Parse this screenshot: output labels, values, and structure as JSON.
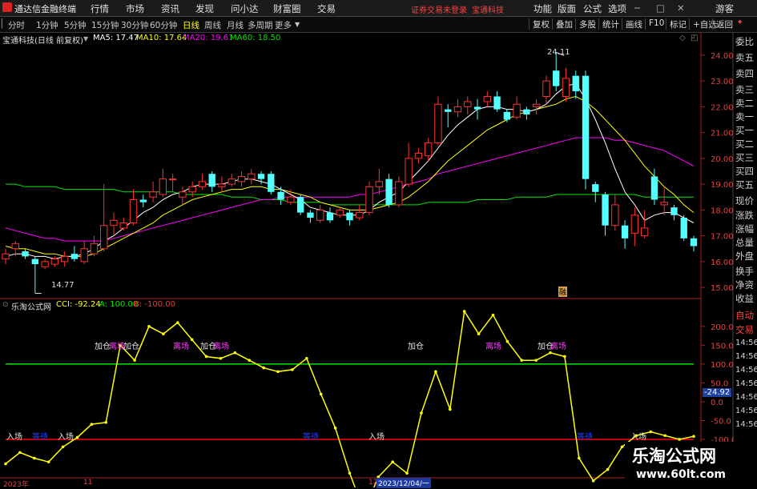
{
  "app": {
    "title": "通达信金融终端"
  },
  "menu": {
    "items": [
      "行情",
      "市场",
      "资讯",
      "发现",
      "问小达",
      "财富圈",
      "交易"
    ],
    "warning": "证券交易未登录",
    "broker": "宝通科技",
    "right_items": [
      "功能",
      "版面",
      "公式",
      "选项"
    ],
    "guest": "游客"
  },
  "toolbar": {
    "periods": [
      "分时",
      "1分钟",
      "5分钟",
      "15分钟",
      "30分钟",
      "60分钟",
      "日线",
      "周线",
      "月线",
      "多周期",
      "更多"
    ],
    "active": "日线",
    "right_buttons": [
      "复权",
      "叠加",
      "多股",
      "统计",
      "画线",
      "F10",
      "标记",
      "+自选",
      "返回"
    ]
  },
  "stock": {
    "name": "宝通科技(日线 前复权)",
    "ma5": "MA5: 17.47",
    "ma10": "MA10: 17.64",
    "ma20": "MA20: 19.61",
    "ma60": "MA60: 18.50",
    "high_label": "24.11",
    "low_label": "14.77",
    "badge": "融"
  },
  "indicator": {
    "title": "乐淘公式网",
    "cci": "CCI: -92.24",
    "a": "A: 100.00",
    "b": "B: -100.00",
    "current_value": "-24.92"
  },
  "signals": {
    "ruchang": "入场",
    "jiacang": "加仓",
    "lichang": "离场",
    "dengdai": "等待"
  },
  "x_axis": {
    "labels": [
      "2023年",
      "11",
      "12",
      "2023/12/04/一"
    ]
  },
  "side_panel": {
    "items": [
      "委比",
      "卖五",
      "卖四",
      "卖三",
      "卖二",
      "卖一",
      "买一",
      "买二",
      "买三",
      "买四",
      "买五",
      "现价",
      "涨跌",
      "涨幅",
      "总量",
      "外盘",
      "换手",
      "净资",
      "收益",
      "自动",
      "交易"
    ]
  },
  "right_scale": {
    "items": [
      "14:56",
      "14:56",
      "14:56",
      "14:56",
      "14:56",
      "14:56",
      "14:56"
    ]
  },
  "watermark": {
    "brand": "乐淘公式网",
    "url": "www.60lt.com"
  },
  "colors": {
    "up": "#ff3232",
    "down": "#54ffff",
    "ma5": "#ffffff",
    "ma10": "#ffff00",
    "ma20": "#ff00ff",
    "ma60": "#00e600",
    "cci": "#ffff00",
    "line_a": "#00e600",
    "line_b": "#ff0000"
  },
  "chart_data": [
    {
      "type": "candlestick",
      "title": "宝通科技(日线 前复权)",
      "ylim": [
        14.6,
        24.4
      ],
      "y_ticks": [
        15,
        16,
        17,
        18,
        19,
        20,
        21,
        22,
        23,
        24
      ],
      "y_tick_labels": [
        "15.00",
        "16.00",
        "17.00",
        "18.00",
        "19.00",
        "20.00",
        "21.00",
        "22.00",
        "23.00",
        "24.00"
      ],
      "candles": [
        {
          "o": 16.1,
          "c": 16.3,
          "h": 16.5,
          "l": 15.9
        },
        {
          "o": 16.5,
          "c": 16.7,
          "h": 16.8,
          "l": 16.2
        },
        {
          "o": 16.4,
          "c": 16.2,
          "h": 16.5,
          "l": 16.1
        },
        {
          "o": 16.1,
          "c": 15.9,
          "h": 16.2,
          "l": 14.77
        },
        {
          "o": 15.8,
          "c": 16.0,
          "h": 16.1,
          "l": 15.7
        },
        {
          "o": 15.9,
          "c": 16.1,
          "h": 16.2,
          "l": 15.8
        },
        {
          "o": 16.0,
          "c": 16.2,
          "h": 16.4,
          "l": 15.8
        },
        {
          "o": 16.3,
          "c": 16.1,
          "h": 16.6,
          "l": 16.0
        },
        {
          "o": 16.0,
          "c": 16.5,
          "h": 16.8,
          "l": 15.9
        },
        {
          "o": 16.3,
          "c": 16.7,
          "h": 17.0,
          "l": 16.2
        },
        {
          "o": 16.5,
          "c": 17.4,
          "h": 19.0,
          "l": 16.4
        },
        {
          "o": 17.4,
          "c": 17.6,
          "h": 17.9,
          "l": 17.0
        },
        {
          "o": 17.3,
          "c": 17.5,
          "h": 17.7,
          "l": 17.2
        },
        {
          "o": 17.5,
          "c": 18.4,
          "h": 18.8,
          "l": 17.4
        },
        {
          "o": 18.4,
          "c": 18.3,
          "h": 18.6,
          "l": 18.1
        },
        {
          "o": 18.5,
          "c": 18.7,
          "h": 19.1,
          "l": 18.3
        },
        {
          "o": 18.6,
          "c": 19.2,
          "h": 19.6,
          "l": 18.5
        },
        {
          "o": 19.2,
          "c": 19.2,
          "h": 19.4,
          "l": 18.7
        },
        {
          "o": 18.5,
          "c": 18.7,
          "h": 18.9,
          "l": 18.2
        },
        {
          "o": 18.7,
          "c": 18.9,
          "h": 19.1,
          "l": 18.5
        },
        {
          "o": 18.9,
          "c": 19.1,
          "h": 19.4,
          "l": 18.8
        },
        {
          "o": 19.4,
          "c": 18.9,
          "h": 19.5,
          "l": 18.7
        },
        {
          "o": 18.9,
          "c": 19.0,
          "h": 19.3,
          "l": 18.7
        },
        {
          "o": 19.0,
          "c": 19.2,
          "h": 19.4,
          "l": 18.9
        },
        {
          "o": 19.1,
          "c": 19.3,
          "h": 19.5,
          "l": 18.9
        },
        {
          "o": 19.2,
          "c": 19.4,
          "h": 19.6,
          "l": 19.0
        },
        {
          "o": 19.4,
          "c": 19.2,
          "h": 19.5,
          "l": 19.0
        },
        {
          "o": 19.4,
          "c": 18.7,
          "h": 19.5,
          "l": 18.6
        },
        {
          "o": 18.7,
          "c": 18.4,
          "h": 18.9,
          "l": 18.2
        },
        {
          "o": 18.3,
          "c": 18.5,
          "h": 18.8,
          "l": 18.2
        },
        {
          "o": 18.5,
          "c": 17.9,
          "h": 18.6,
          "l": 17.8
        },
        {
          "o": 17.9,
          "c": 17.7,
          "h": 18.0,
          "l": 17.5
        },
        {
          "o": 17.6,
          "c": 18.0,
          "h": 18.2,
          "l": 17.5
        },
        {
          "o": 17.9,
          "c": 17.6,
          "h": 18.1,
          "l": 17.5
        },
        {
          "o": 17.8,
          "c": 18.0,
          "h": 18.1,
          "l": 17.7
        },
        {
          "o": 17.9,
          "c": 17.6,
          "h": 18.0,
          "l": 17.4
        },
        {
          "o": 17.7,
          "c": 17.9,
          "h": 18.2,
          "l": 17.6
        },
        {
          "o": 17.9,
          "c": 18.9,
          "h": 19.1,
          "l": 17.8
        },
        {
          "o": 18.9,
          "c": 19.1,
          "h": 19.6,
          "l": 18.6
        },
        {
          "o": 19.2,
          "c": 18.2,
          "h": 19.4,
          "l": 18.1
        },
        {
          "o": 18.2,
          "c": 19.1,
          "h": 19.3,
          "l": 18.1
        },
        {
          "o": 19.0,
          "c": 20.0,
          "h": 20.6,
          "l": 18.9
        },
        {
          "o": 20.0,
          "c": 20.2,
          "h": 20.4,
          "l": 19.8
        },
        {
          "o": 20.1,
          "c": 20.6,
          "h": 20.8,
          "l": 19.9
        },
        {
          "o": 20.6,
          "c": 22.1,
          "h": 22.4,
          "l": 20.5
        },
        {
          "o": 21.9,
          "c": 21.8,
          "h": 22.1,
          "l": 21.2
        },
        {
          "o": 21.8,
          "c": 22.0,
          "h": 22.3,
          "l": 21.6
        },
        {
          "o": 22.0,
          "c": 22.2,
          "h": 22.4,
          "l": 21.7
        },
        {
          "o": 22.0,
          "c": 21.9,
          "h": 22.3,
          "l": 21.5
        },
        {
          "o": 22.2,
          "c": 22.4,
          "h": 22.6,
          "l": 22.0
        },
        {
          "o": 22.4,
          "c": 21.9,
          "h": 22.6,
          "l": 21.8
        },
        {
          "o": 21.8,
          "c": 21.5,
          "h": 21.9,
          "l": 21.4
        },
        {
          "o": 21.6,
          "c": 22.1,
          "h": 22.4,
          "l": 21.5
        },
        {
          "o": 21.9,
          "c": 21.7,
          "h": 22.0,
          "l": 21.5
        },
        {
          "o": 22.0,
          "c": 22.1,
          "h": 22.3,
          "l": 21.7
        },
        {
          "o": 22.4,
          "c": 23.0,
          "h": 23.2,
          "l": 22.1
        },
        {
          "o": 23.4,
          "c": 22.8,
          "h": 24.11,
          "l": 22.6
        },
        {
          "o": 22.4,
          "c": 23.1,
          "h": 23.5,
          "l": 22.2
        },
        {
          "o": 23.2,
          "c": 22.6,
          "h": 23.4,
          "l": 22.3
        },
        {
          "o": 23.2,
          "c": 19.2,
          "h": 23.4,
          "l": 18.8
        },
        {
          "o": 19.0,
          "c": 18.7,
          "h": 19.1,
          "l": 18.3
        },
        {
          "o": 18.6,
          "c": 17.4,
          "h": 18.7,
          "l": 17.0
        },
        {
          "o": 17.4,
          "c": 18.2,
          "h": 18.6,
          "l": 17.2
        },
        {
          "o": 17.4,
          "c": 16.9,
          "h": 17.6,
          "l": 16.5
        },
        {
          "o": 17.1,
          "c": 17.8,
          "h": 18.1,
          "l": 16.6
        },
        {
          "o": 17.0,
          "c": 17.3,
          "h": 18.0,
          "l": 16.9
        },
        {
          "o": 19.3,
          "c": 18.4,
          "h": 19.6,
          "l": 18.2
        },
        {
          "o": 18.2,
          "c": 18.3,
          "h": 18.9,
          "l": 17.8
        },
        {
          "o": 18.1,
          "c": 17.8,
          "h": 18.2,
          "l": 17.6
        },
        {
          "o": 17.7,
          "c": 16.9,
          "h": 17.8,
          "l": 16.8
        },
        {
          "o": 16.9,
          "c": 16.6,
          "h": 17.0,
          "l": 16.4
        }
      ],
      "ma5": [
        16.2,
        16.3,
        16.3,
        16.2,
        16.2,
        16.1,
        16.2,
        16.2,
        16.3,
        16.5,
        16.8,
        17.0,
        17.3,
        17.6,
        17.9,
        18.1,
        18.4,
        18.6,
        18.7,
        18.9,
        19.0,
        19.0,
        19.0,
        19.1,
        19.2,
        19.2,
        19.1,
        19.0,
        18.8,
        18.6,
        18.4,
        18.1,
        18.0,
        17.9,
        17.8,
        17.8,
        17.8,
        18.0,
        18.3,
        18.5,
        18.7,
        19.1,
        19.5,
        19.9,
        20.4,
        20.9,
        21.3,
        21.6,
        21.9,
        22.0,
        22.0,
        21.9,
        21.9,
        21.8,
        21.9,
        22.1,
        22.5,
        22.8,
        22.9,
        22.3,
        21.5,
        20.6,
        19.6,
        18.7,
        18.2,
        17.6,
        17.8,
        17.9,
        17.9,
        17.7,
        17.5
      ],
      "ma10": [
        16.6,
        16.5,
        16.5,
        16.4,
        16.3,
        16.3,
        16.2,
        16.2,
        16.2,
        16.3,
        16.5,
        16.7,
        16.9,
        17.1,
        17.3,
        17.5,
        17.8,
        18.0,
        18.2,
        18.4,
        18.5,
        18.6,
        18.7,
        18.8,
        18.8,
        18.9,
        18.9,
        18.8,
        18.8,
        18.7,
        18.6,
        18.5,
        18.3,
        18.2,
        18.1,
        18.0,
        18.0,
        18.0,
        18.1,
        18.2,
        18.3,
        18.5,
        18.8,
        19.1,
        19.5,
        19.9,
        20.2,
        20.5,
        20.8,
        21.1,
        21.3,
        21.5,
        21.7,
        21.8,
        21.9,
        22.0,
        22.1,
        22.3,
        22.4,
        22.2,
        21.9,
        21.5,
        21.1,
        20.7,
        20.2,
        19.7,
        19.3,
        18.9,
        18.6,
        18.2,
        17.9
      ],
      "ma20": [
        17.3,
        17.2,
        17.1,
        17.0,
        16.9,
        16.9,
        16.8,
        16.8,
        16.8,
        16.8,
        16.8,
        16.9,
        17.0,
        17.1,
        17.2,
        17.3,
        17.4,
        17.5,
        17.6,
        17.7,
        17.8,
        17.9,
        18.0,
        18.1,
        18.2,
        18.3,
        18.4,
        18.4,
        18.5,
        18.5,
        18.5,
        18.5,
        18.5,
        18.5,
        18.5,
        18.5,
        18.6,
        18.6,
        18.7,
        18.8,
        18.9,
        19.0,
        19.1,
        19.2,
        19.4,
        19.5,
        19.6,
        19.7,
        19.8,
        19.9,
        20.0,
        20.1,
        20.2,
        20.3,
        20.4,
        20.5,
        20.6,
        20.7,
        20.8,
        20.8,
        20.8,
        20.8,
        20.7,
        20.7,
        20.6,
        20.5,
        20.4,
        20.3,
        20.1,
        19.9,
        19.7
      ],
      "ma60": [
        19.0,
        19.0,
        18.9,
        18.9,
        18.9,
        18.9,
        18.8,
        18.8,
        18.8,
        18.8,
        18.8,
        18.8,
        18.7,
        18.7,
        18.7,
        18.7,
        18.7,
        18.7,
        18.6,
        18.6,
        18.6,
        18.6,
        18.6,
        18.5,
        18.5,
        18.5,
        18.4,
        18.4,
        18.4,
        18.3,
        18.3,
        18.3,
        18.3,
        18.2,
        18.2,
        18.2,
        18.2,
        18.2,
        18.2,
        18.2,
        18.2,
        18.2,
        18.2,
        18.3,
        18.3,
        18.3,
        18.3,
        18.3,
        18.4,
        18.4,
        18.4,
        18.4,
        18.5,
        18.5,
        18.5,
        18.5,
        18.6,
        18.6,
        18.6,
        18.6,
        18.6,
        18.6,
        18.6,
        18.6,
        18.6,
        18.5,
        18.5,
        18.5,
        18.5,
        18.5,
        18.5
      ]
    },
    {
      "type": "line",
      "title": "CCI",
      "ylim": [
        -200,
        240
      ],
      "y_ticks": [
        200,
        150,
        100,
        50,
        0,
        -50,
        -100,
        -150
      ],
      "series": [
        {
          "name": "CCI",
          "values": [
            -165,
            -135,
            -150,
            -160,
            -120,
            -95,
            -60,
            -55,
            150,
            110,
            200,
            180,
            210,
            165,
            120,
            115,
            130,
            110,
            90,
            80,
            85,
            115,
            20,
            -70,
            -190,
            -290,
            -200,
            -160,
            -190,
            -30,
            80,
            -20,
            240,
            180,
            230,
            160,
            110,
            110,
            130,
            120,
            -150,
            -210,
            -180,
            -120,
            -90,
            -80,
            -90,
            -100,
            -92
          ]
        }
      ],
      "lines": {
        "A": 100,
        "B": -100
      }
    }
  ]
}
